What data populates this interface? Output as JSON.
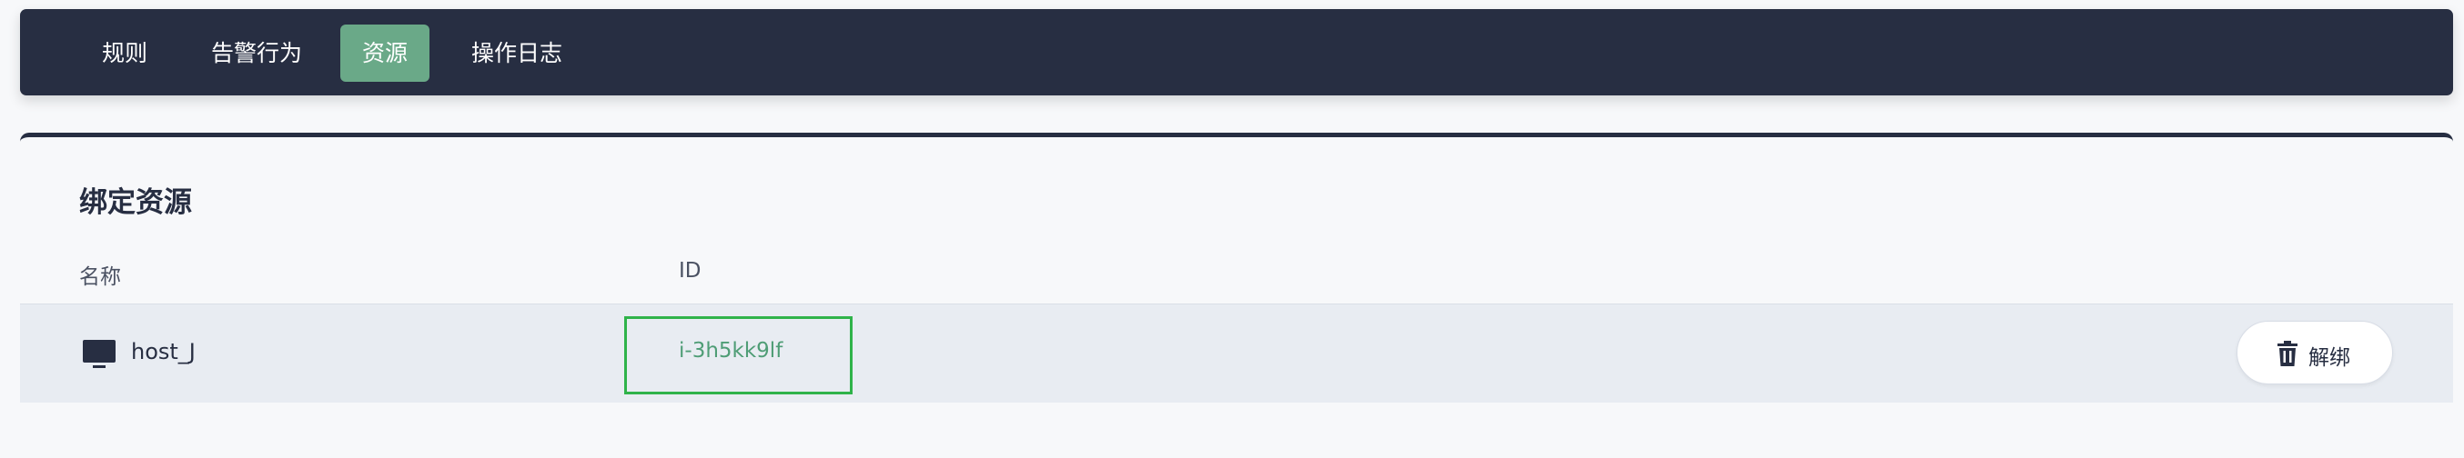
{
  "nav": {
    "tabs": [
      {
        "label": "规则",
        "active": false
      },
      {
        "label": "告警行为",
        "active": false
      },
      {
        "label": "资源",
        "active": true
      },
      {
        "label": "操作日志",
        "active": false
      }
    ]
  },
  "panel": {
    "title": "绑定资源",
    "columns": {
      "name": "名称",
      "id": "ID"
    },
    "rows": [
      {
        "icon": "monitor-icon",
        "name": "host_J",
        "id": "i-3h5kk9lf",
        "action": {
          "icon": "trash-icon",
          "label": "解绑"
        }
      }
    ]
  },
  "colors": {
    "nav_bg": "#272e42",
    "active_tab": "#6aa988",
    "id_link": "#4f9d76",
    "highlight_box": "#2fb34a",
    "row_bg": "#e8ecf2"
  }
}
